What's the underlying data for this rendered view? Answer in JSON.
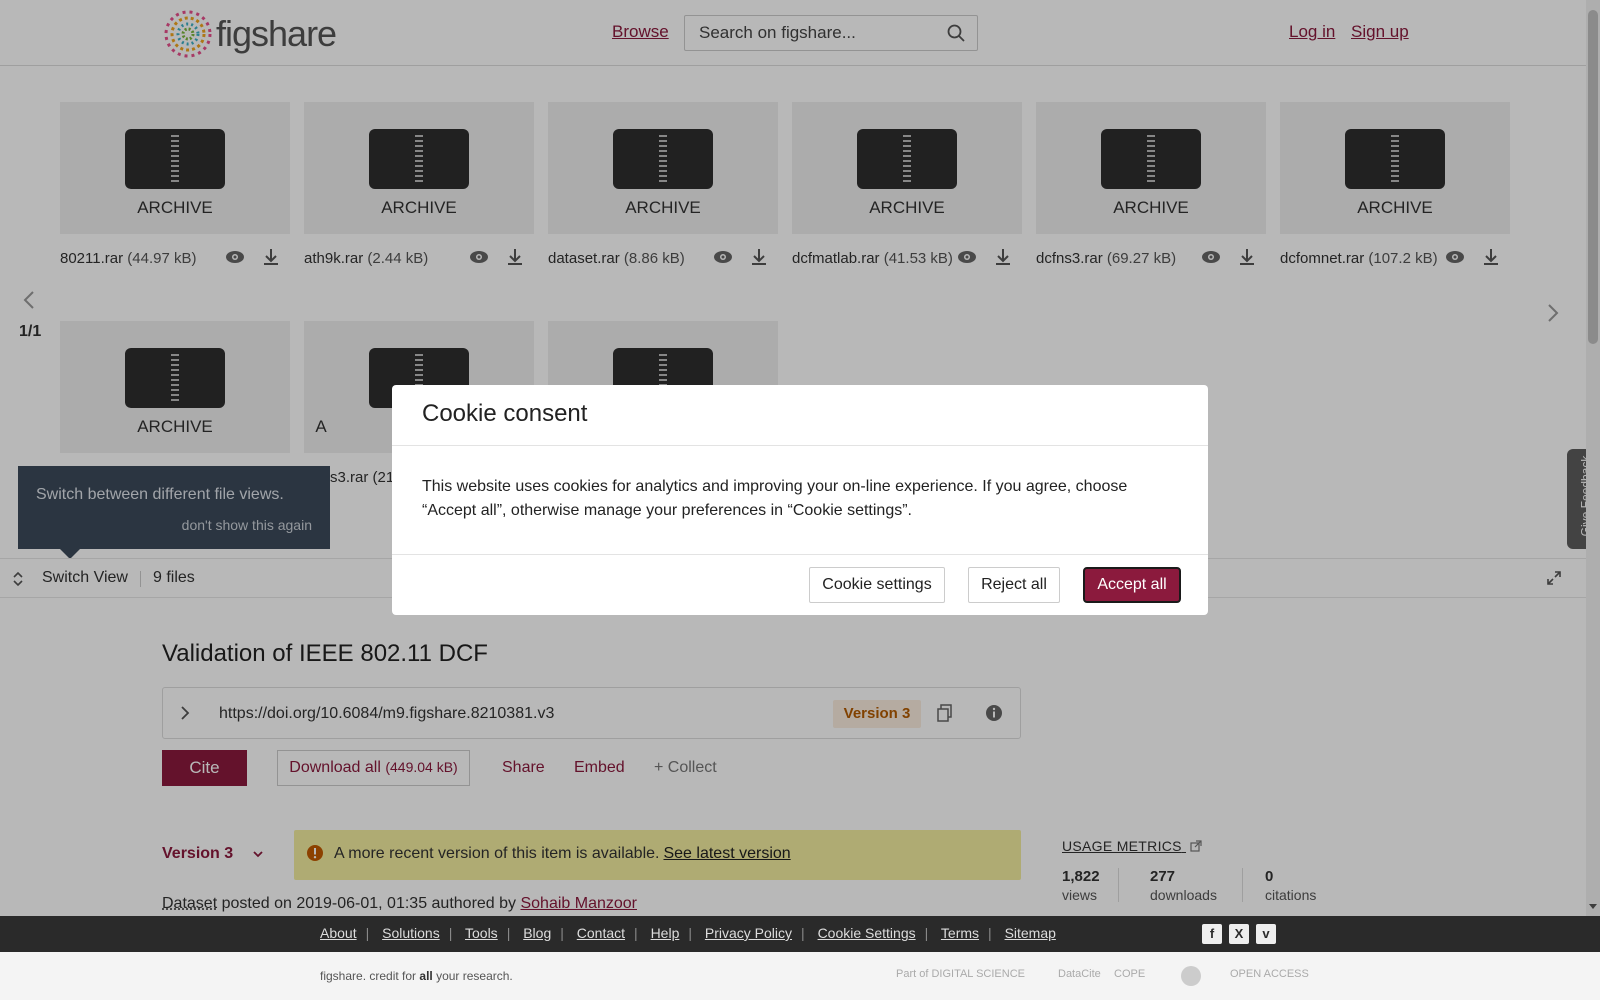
{
  "header": {
    "logo_text": "figshare",
    "browse": "Browse",
    "search_placeholder": "Search on figshare...",
    "login": "Log in",
    "signup": "Sign up"
  },
  "files": [
    {
      "label": "ARCHIVE",
      "name": "80211.rar",
      "size": "(44.97 kB)"
    },
    {
      "label": "ARCHIVE",
      "name": "ath9k.rar",
      "size": "(2.44 kB)"
    },
    {
      "label": "ARCHIVE",
      "name": "dataset.rar",
      "size": "(8.86 kB)"
    },
    {
      "label": "ARCHIVE",
      "name": "dcfmatlab.rar",
      "size": "(41.53 kB)"
    },
    {
      "label": "ARCHIVE",
      "name": "dcfns3.rar",
      "size": "(69.27 kB)"
    },
    {
      "label": "ARCHIVE",
      "name": "dcfomnet.rar",
      "size": "(107.2 kB)"
    },
    {
      "label": "ARCHIVE"
    },
    {
      "label": "A",
      "partial_name": "s3.rar (21."
    },
    {
      "label": ""
    }
  ],
  "pager": "1/1",
  "tooltip": {
    "text": "Switch between different file views.",
    "dismiss": "don't show this again"
  },
  "toolbar": {
    "switch_view": "Switch View",
    "file_count": "9 files"
  },
  "article": {
    "title": "Validation of IEEE 802.11 DCF",
    "doi": "https://doi.org/10.6084/m9.figshare.8210381.v3",
    "version_badge": "Version 3",
    "cite": "Cite",
    "download_all": "Download all",
    "download_size": "(449.04 kB)",
    "share": "Share",
    "embed": "Embed",
    "collect": "+ Collect",
    "version_select": "Version 3",
    "alert_text": "A more recent version of this item is available.",
    "alert_link": "See latest version",
    "meta_type": "Dataset",
    "meta_posted": " posted on 2019-06-01, 01:35 authored by ",
    "meta_author": "Sohaib Manzoor"
  },
  "metrics": {
    "title": "USAGE METRICS",
    "views": {
      "value": "1,822",
      "label": "views"
    },
    "downloads": {
      "value": "277",
      "label": "downloads"
    },
    "citations": {
      "value": "0",
      "label": "citations"
    }
  },
  "feedback": "Give Feedback",
  "cookie": {
    "title": "Cookie consent",
    "body": "This website uses cookies for analytics and improving your on-line experience. If you agree, choose “Accept all”, otherwise manage your preferences in “Cookie settings”.",
    "settings": "Cookie settings",
    "reject": "Reject all",
    "accept": "Accept all"
  },
  "footer": {
    "links": [
      "About",
      "Solutions",
      "Tools",
      "Blog",
      "Contact",
      "Help",
      "Privacy Policy",
      "Cookie Settings",
      "Terms",
      "Sitemap"
    ],
    "social": [
      "f",
      "X",
      "v"
    ],
    "tagline_brand": "figshare",
    "tagline_mid": ". credit for ",
    "tagline_bold": "all",
    "tagline_end": " your research.",
    "partner_logos": [
      "Part of DIGITAL SCIENCE",
      "DataCite",
      "COPE",
      "",
      "OPEN ACCESS"
    ]
  },
  "colors": {
    "brand": "#8b1a3d",
    "alert_bg": "#f3eda0",
    "footer_bg": "#2a2a2a"
  }
}
